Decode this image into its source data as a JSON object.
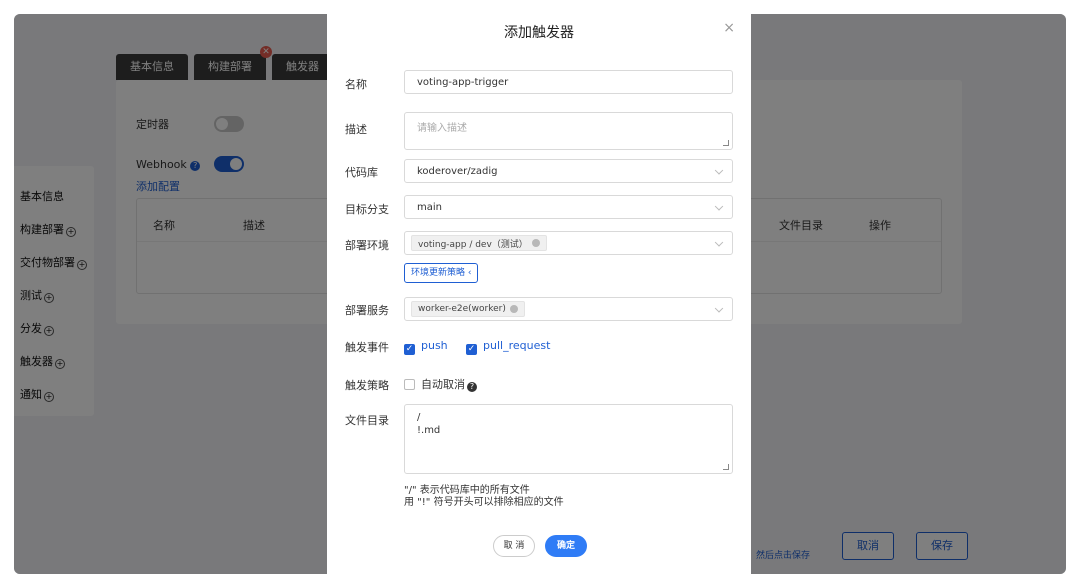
{
  "bg": {
    "tabs": [
      "基本信息",
      "构建部署",
      "触发器"
    ],
    "timer_label": "定时器",
    "webhook_label": "Webhook",
    "add_config": "添加配置",
    "table_headers": [
      "名称",
      "描述",
      "文件目录",
      "操作"
    ],
    "nav": [
      "基本信息",
      "构建部署",
      "交付物部署",
      "测试",
      "分发",
      "触发器",
      "通知"
    ],
    "save_hint": "然后点击保存",
    "cancel_btn": "取消",
    "save_btn": "保存"
  },
  "modal": {
    "title": "添加触发器",
    "close": "×",
    "name_label": "名称",
    "name_value": "voting-app-trigger",
    "desc_label": "描述",
    "desc_placeholder": "请输入描述",
    "repo_label": "代码库",
    "repo_value": "koderover/zadig",
    "branch_label": "目标分支",
    "branch_value": "main",
    "env_label": "部署环境",
    "env_tag": "voting-app / dev（测试）",
    "env_strategy": "环境更新策略 ‹",
    "service_label": "部署服务",
    "service_tag": "worker-e2e(worker)",
    "event_label": "触发事件",
    "event_push": "push",
    "event_pr": "pull_request",
    "strategy_label": "触发策略",
    "auto_cancel": "自动取消",
    "dir_label": "文件目录",
    "dir_line1": "/",
    "dir_line2": "!.md",
    "hint1": "\"/\" 表示代码库中的所有文件",
    "hint2": "用 \"!\" 符号开头可以排除相应的文件",
    "cancel": "取 消",
    "ok": "确定"
  }
}
